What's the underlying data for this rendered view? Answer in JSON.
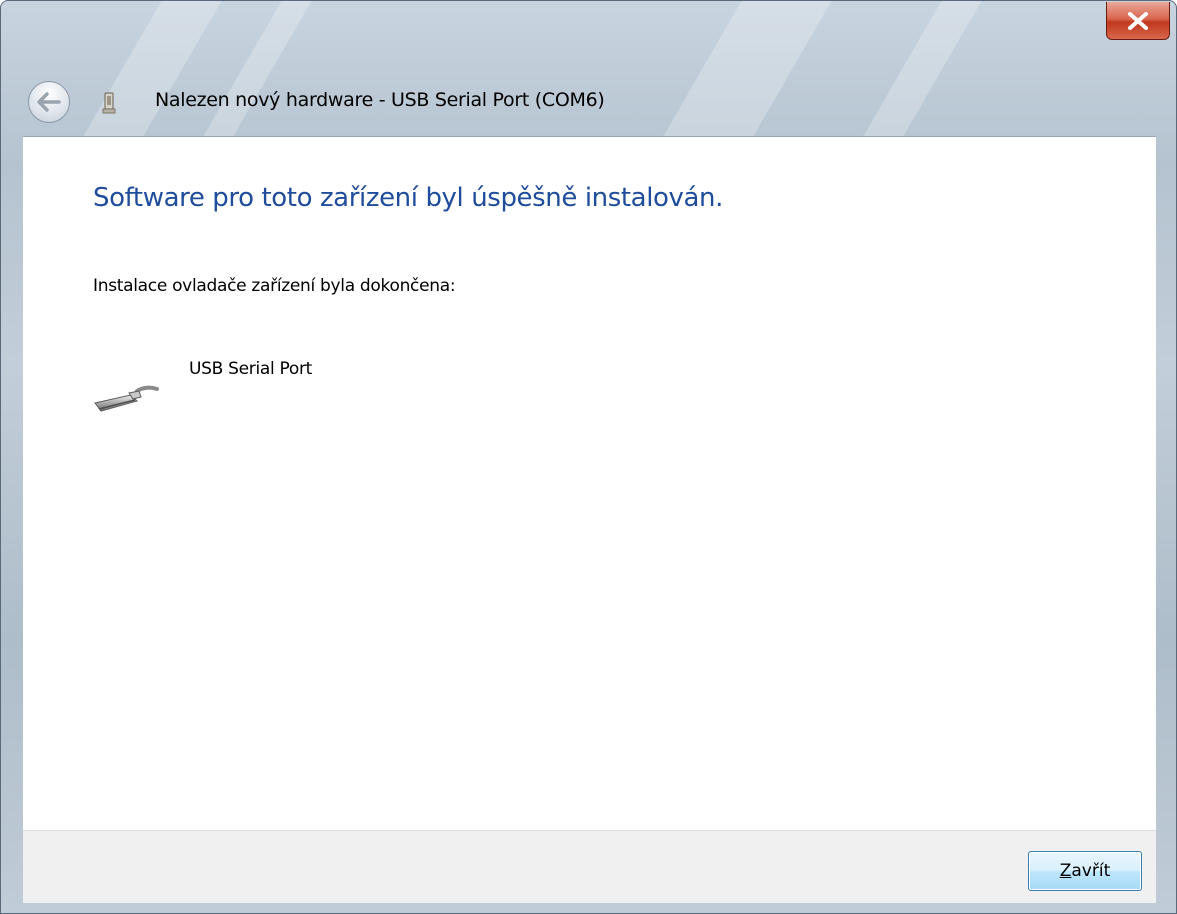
{
  "window": {
    "title": "Nalezen nový hardware - USB Serial Port (COM6)",
    "close_icon": "close-x-icon",
    "back_icon": "back-arrow-icon",
    "hardware_icon": "usb-device-icon"
  },
  "content": {
    "heading": "Software pro toto zařízení byl úspěšně instalován.",
    "message": "Instalace ovladače zařízení byla dokončena:",
    "device": {
      "name": "USB Serial Port",
      "icon": "serial-port-icon"
    }
  },
  "footer": {
    "close_button": {
      "mnemonic": "Z",
      "rest": "avřít"
    }
  },
  "colors": {
    "heading": "#1f4d9c",
    "close_button_red": "#c0391e",
    "button_border": "#3c7fb1"
  }
}
